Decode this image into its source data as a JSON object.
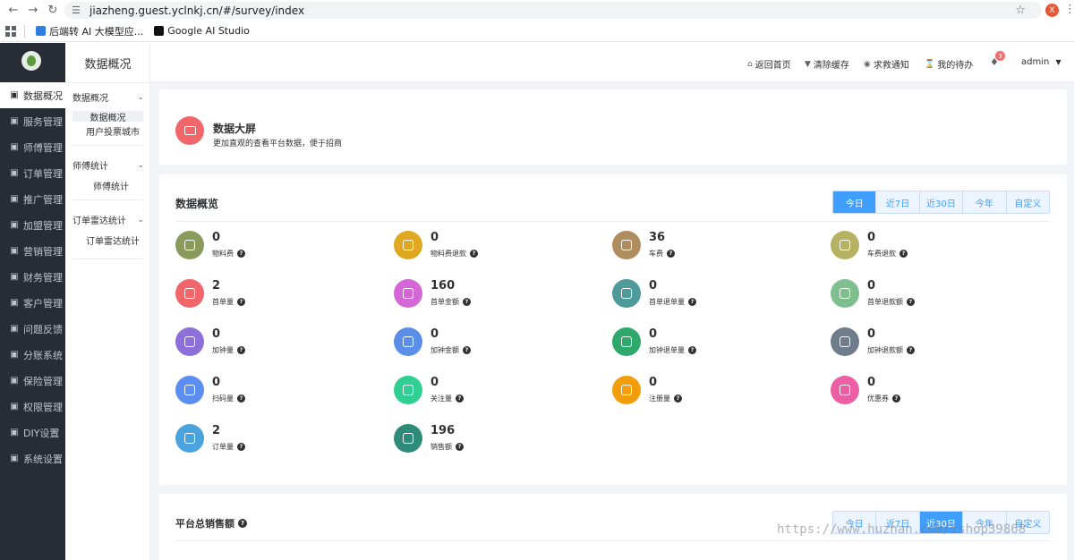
{
  "browser": {
    "url": "jiazheng.guest.yclnkj.cn/#/survey/index",
    "profile_initial": "X",
    "bookmarks": [
      {
        "label": "后端转 AI 大模型应...",
        "color": "blue"
      },
      {
        "label": "Google AI Studio",
        "color": "black"
      }
    ]
  },
  "sidebar": {
    "items": [
      {
        "label": "数据概况",
        "icon": "pie-chart-icon"
      },
      {
        "label": "服务管理",
        "icon": "service-icon"
      },
      {
        "label": "师傅管理",
        "icon": "headset-icon"
      },
      {
        "label": "订单管理",
        "icon": "order-icon"
      },
      {
        "label": "推广管理",
        "icon": "promotion-icon"
      },
      {
        "label": "加盟管理",
        "icon": "franchise-icon"
      },
      {
        "label": "营销管理",
        "icon": "marketing-icon"
      },
      {
        "label": "财务管理",
        "icon": "finance-icon"
      },
      {
        "label": "客户管理",
        "icon": "customer-icon"
      },
      {
        "label": "问题反馈",
        "icon": "feedback-icon"
      },
      {
        "label": "分账系统",
        "icon": "split-icon"
      },
      {
        "label": "保险管理",
        "icon": "shield-icon"
      },
      {
        "label": "权限管理",
        "icon": "permission-icon"
      },
      {
        "label": "DIY设置",
        "icon": "diy-icon"
      },
      {
        "label": "系统设置",
        "icon": "gear-icon"
      }
    ]
  },
  "subside": {
    "title": "数据概况",
    "groups": [
      {
        "head": "数据概况",
        "links": [
          "数据概况",
          "用户投票城市"
        ]
      },
      {
        "head": "师傅统计",
        "links": [
          "师傅统计"
        ]
      },
      {
        "head": "订单雷达统计",
        "links": [
          "订单雷达统计"
        ]
      }
    ]
  },
  "header": {
    "links": [
      "返回首页",
      "清除缓存",
      "求救通知",
      "我的待办"
    ],
    "bell_count": "3",
    "user": "admin"
  },
  "big_screen": {
    "title": "数据大屏",
    "desc": "更加直观的查看平台数据，便于招商"
  },
  "overview": {
    "title": "数据概览",
    "tabs": [
      "今日",
      "近7日",
      "近30日",
      "今年",
      "自定义"
    ],
    "active_tab": "今日",
    "stats": [
      {
        "value": "0",
        "label": "物料费",
        "color": "#8a9a5b"
      },
      {
        "value": "0",
        "label": "物料费退款",
        "color": "#e0a820"
      },
      {
        "value": "36",
        "label": "车费",
        "color": "#b08d5e"
      },
      {
        "value": "0",
        "label": "车费退款",
        "color": "#b5b363"
      },
      {
        "value": "2",
        "label": "首单量",
        "color": "#f0666a"
      },
      {
        "value": "160",
        "label": "首单金额",
        "color": "#d466d6"
      },
      {
        "value": "0",
        "label": "首单退单量",
        "color": "#4f9a9a"
      },
      {
        "value": "0",
        "label": "首单退款额",
        "color": "#7fbf8e"
      },
      {
        "value": "0",
        "label": "加钟量",
        "color": "#8c6fd8"
      },
      {
        "value": "0",
        "label": "加钟金额",
        "color": "#5b8ee6"
      },
      {
        "value": "0",
        "label": "加钟退单量",
        "color": "#2ea86b"
      },
      {
        "value": "0",
        "label": "加钟退款额",
        "color": "#6e7c8c"
      },
      {
        "value": "0",
        "label": "扫码量",
        "color": "#5b8ef0"
      },
      {
        "value": "0",
        "label": "关注量",
        "color": "#2fcf94"
      },
      {
        "value": "0",
        "label": "注册量",
        "color": "#f29d0c"
      },
      {
        "value": "0",
        "label": "优惠券",
        "color": "#ec5fa4"
      },
      {
        "value": "2",
        "label": "订单量",
        "color": "#4aa3dc"
      },
      {
        "value": "196",
        "label": "销售额",
        "color": "#2e8b7a"
      }
    ]
  },
  "sales": {
    "title": "平台总销售额",
    "tabs": [
      "今日",
      "近7日",
      "近30日",
      "今年",
      "自定义"
    ],
    "active_tab": "近30日"
  },
  "watermark": "https://www.huzhan.com/ishop39868"
}
